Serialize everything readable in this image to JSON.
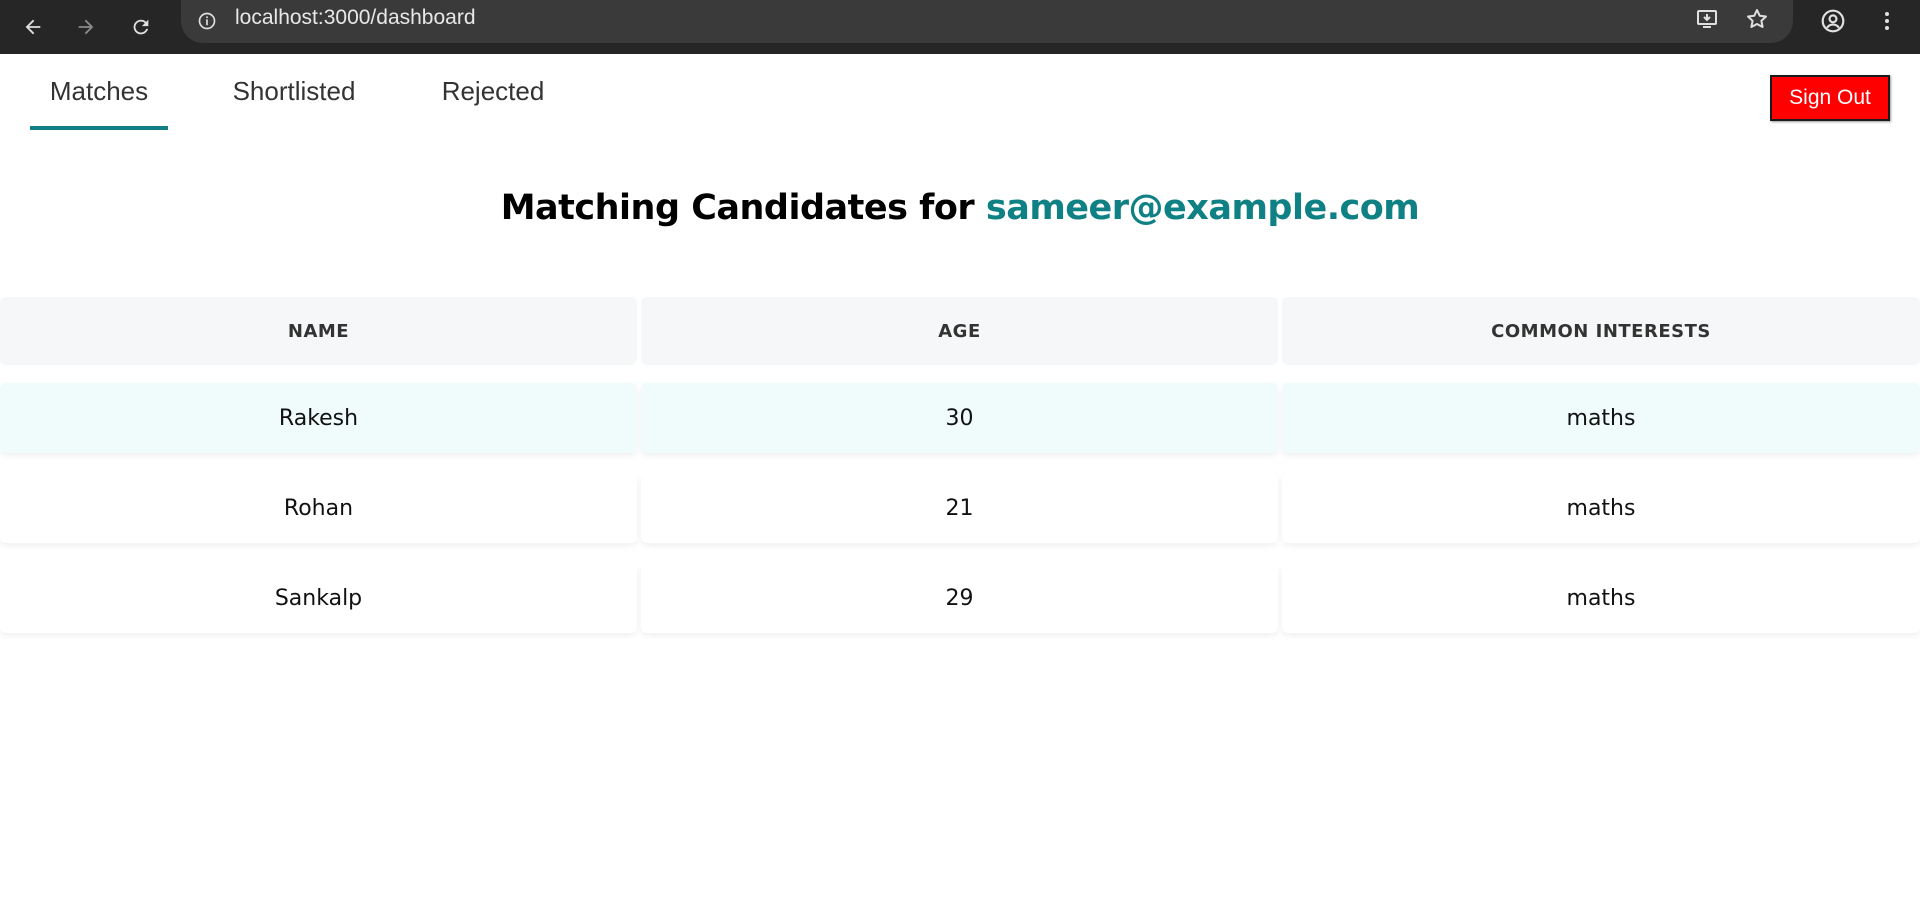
{
  "browser": {
    "url": "localhost:3000/dashboard",
    "icons": [
      "back-icon",
      "forward-icon",
      "reload-icon",
      "site-info-icon",
      "install-app-icon",
      "bookmark-star-icon",
      "profile-icon",
      "menu-dots-icon"
    ]
  },
  "tabs": [
    {
      "label": "Matches",
      "active": true
    },
    {
      "label": "Shortlisted",
      "active": false
    },
    {
      "label": "Rejected",
      "active": false
    }
  ],
  "signout_label": "Sign Out",
  "heading": {
    "prefix": "Matching Candidates for",
    "email": "sameer@example.com"
  },
  "table": {
    "headers": [
      "NAME",
      "AGE",
      "COMMON INTERESTS"
    ],
    "rows": [
      {
        "name": "Rakesh",
        "age": "30",
        "interests": "maths"
      },
      {
        "name": "Rohan",
        "age": "21",
        "interests": "maths"
      },
      {
        "name": "Sankalp",
        "age": "29",
        "interests": "maths"
      }
    ]
  },
  "colors": {
    "accent": "#0f8184",
    "signout": "#ff0000",
    "chrome": "#262626"
  }
}
